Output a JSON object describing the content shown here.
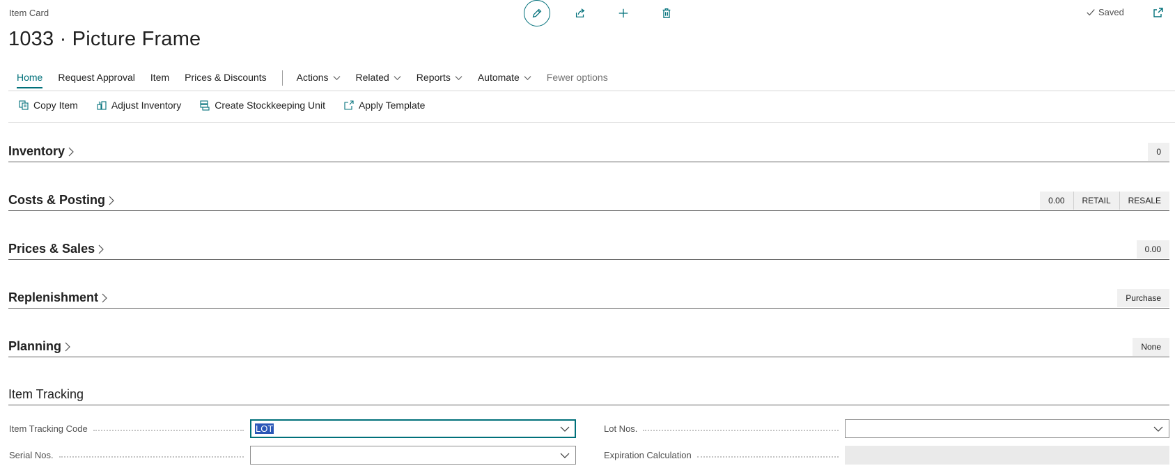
{
  "header": {
    "caption": "Item Card",
    "title": "1033 · Picture Frame",
    "saved_label": "Saved",
    "icons": [
      "edit-icon",
      "share-icon",
      "new-icon",
      "delete-icon",
      "popout-icon"
    ]
  },
  "tabs": [
    {
      "label": "Home",
      "active": true
    },
    {
      "label": "Request Approval"
    },
    {
      "label": "Item"
    },
    {
      "label": "Prices & Discounts"
    },
    {
      "label": "Actions",
      "dropdown": true
    },
    {
      "label": "Related",
      "dropdown": true
    },
    {
      "label": "Reports",
      "dropdown": true
    },
    {
      "label": "Automate",
      "dropdown": true
    },
    {
      "label": "Fewer options",
      "muted": true
    }
  ],
  "actions": [
    {
      "label": "Copy Item",
      "icon": "copy-icon"
    },
    {
      "label": "Adjust Inventory",
      "icon": "adjust-icon"
    },
    {
      "label": "Create Stockkeeping Unit",
      "icon": "stockkeeping-icon"
    },
    {
      "label": "Apply Template",
      "icon": "template-icon"
    }
  ],
  "fasttabs": [
    {
      "title": "Inventory",
      "badges": [
        "0"
      ]
    },
    {
      "title": "Costs & Posting",
      "badges": [
        "0.00",
        "RETAIL",
        "RESALE"
      ]
    },
    {
      "title": "Prices & Sales",
      "badges": [
        "0.00"
      ]
    },
    {
      "title": "Replenishment",
      "badges": [
        "Purchase"
      ]
    },
    {
      "title": "Planning",
      "badges": [
        "None"
      ]
    }
  ],
  "item_tracking": {
    "title": "Item Tracking",
    "tracking_code_label": "Item Tracking Code",
    "tracking_code_value": "LOT",
    "serial_nos_label": "Serial Nos.",
    "serial_nos_value": "",
    "lot_nos_label": "Lot Nos.",
    "lot_nos_value": "",
    "expiration_label": "Expiration Calculation",
    "expiration_value": ""
  },
  "colors": {
    "accent": "#00707a",
    "selection": "#2b57b7"
  }
}
